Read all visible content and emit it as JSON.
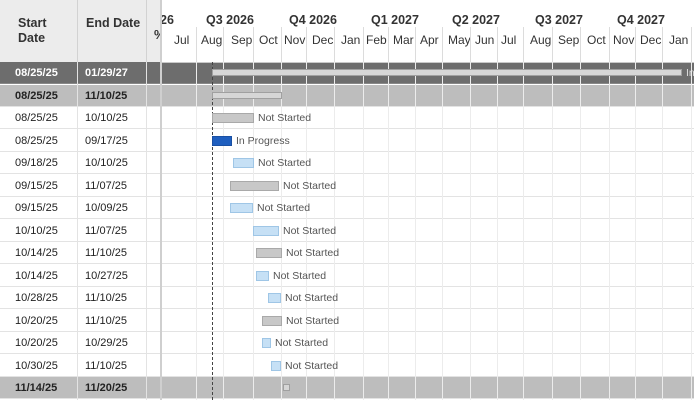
{
  "columns": {
    "start": "Start\nDate",
    "start_l1": "Start",
    "start_l2": "Date",
    "end": "End Date",
    "pct": "%"
  },
  "timeline": {
    "quarters": [
      {
        "label": "Q3 2026",
        "x": 0
      },
      {
        "label": "Q4 2026",
        "x": 0
      },
      {
        "label": "Q1 2027",
        "x": 0
      },
      {
        "label": "Q2 2027",
        "x": 0
      },
      {
        "label": "Q3 2027",
        "x": 0
      },
      {
        "label": "Q4 2027",
        "x": 0
      }
    ],
    "partial_quarter_suffix": "26",
    "months": [
      "Jul",
      "Aug",
      "Sep",
      "Oct",
      "Nov",
      "Dec",
      "Jan",
      "Feb",
      "Mar",
      "Apr",
      "May",
      "Jun",
      "Jul",
      "Aug",
      "Sep",
      "Oct",
      "Nov",
      "Dec",
      "Jan"
    ]
  },
  "rows": [
    {
      "start": "08/25/25",
      "end": "01/29/27",
      "type": "dark",
      "label": "In"
    },
    {
      "start": "08/25/25",
      "end": "11/10/25",
      "type": "summary",
      "label": ""
    },
    {
      "start": "08/25/25",
      "end": "10/10/25",
      "type": "task",
      "status": "Not Started"
    },
    {
      "start": "08/25/25",
      "end": "09/17/25",
      "type": "task",
      "status": "In Progress"
    },
    {
      "start": "09/18/25",
      "end": "10/10/25",
      "type": "task",
      "status": "Not Started"
    },
    {
      "start": "09/15/25",
      "end": "11/07/25",
      "type": "task",
      "status": "Not Started"
    },
    {
      "start": "09/15/25",
      "end": "10/09/25",
      "type": "task",
      "status": "Not Started"
    },
    {
      "start": "10/10/25",
      "end": "11/07/25",
      "type": "task",
      "status": "Not Started"
    },
    {
      "start": "10/14/25",
      "end": "11/10/25",
      "type": "task",
      "status": "Not Started"
    },
    {
      "start": "10/14/25",
      "end": "10/27/25",
      "type": "task",
      "status": "Not Started"
    },
    {
      "start": "10/28/25",
      "end": "11/10/25",
      "type": "task",
      "status": "Not Started"
    },
    {
      "start": "10/20/25",
      "end": "11/10/25",
      "type": "task",
      "status": "Not Started"
    },
    {
      "start": "10/20/25",
      "end": "10/29/25",
      "type": "task",
      "status": "Not Started"
    },
    {
      "start": "10/30/25",
      "end": "11/10/25",
      "type": "task",
      "status": "Not Started"
    },
    {
      "start": "11/14/25",
      "end": "11/20/25",
      "type": "summary",
      "label": ""
    }
  ],
  "colors": {
    "in_progress": "#1f5fbf",
    "not_started_light": "#c6e0f5",
    "not_started_grey": "#c8c8c8",
    "summary_row": "#bdbdbd",
    "dark_row": "#6d6d6d"
  }
}
